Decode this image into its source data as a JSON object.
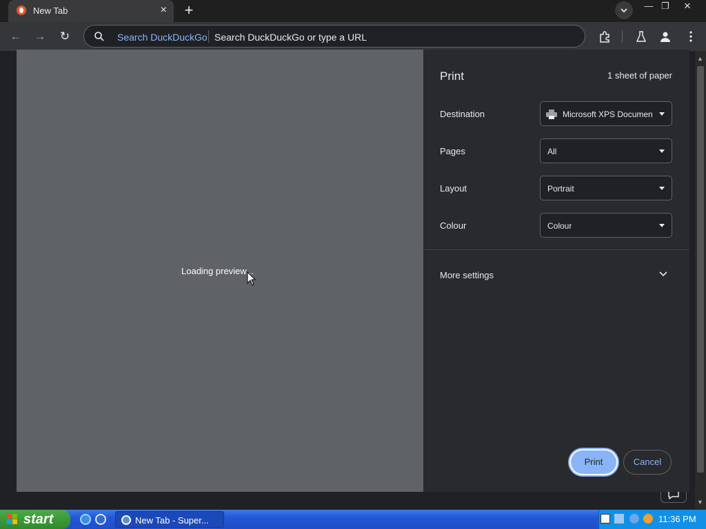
{
  "browser": {
    "tab_title": "New Tab",
    "search_engine_label": "Search DuckDuckGo",
    "omnibox_placeholder": "Search DuckDuckGo or type a URL"
  },
  "print_dialog": {
    "title": "Print",
    "sheet_count": "1 sheet of paper",
    "preview_status": "Loading preview...",
    "fields": [
      {
        "label": "Destination",
        "value": "Microsoft XPS Documen"
      },
      {
        "label": "Pages",
        "value": "All"
      },
      {
        "label": "Layout",
        "value": "Portrait"
      },
      {
        "label": "Colour",
        "value": "Colour"
      }
    ],
    "more_settings": "More settings",
    "print_button": "Print",
    "cancel_button": "Cancel"
  },
  "taskbar": {
    "start_label": "start",
    "task_label": "New Tab - Super...",
    "clock": "11:36 PM"
  },
  "colors": {
    "accent": "#8ab4f8",
    "preview_bg": "#5f6368",
    "panel_bg": "#292a2d"
  }
}
